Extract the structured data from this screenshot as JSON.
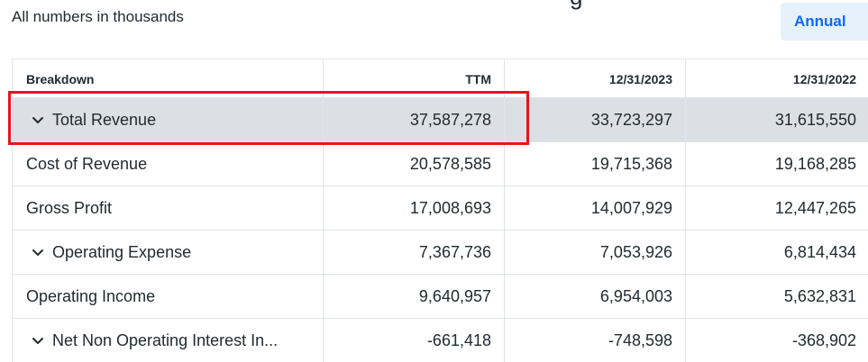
{
  "note": "All numbers in thousands",
  "cut_glyph": "g",
  "frequency": {
    "label": "Annual",
    "accent": "#0f69ff",
    "background": "#e6f2fb"
  },
  "highlight_color": "#e8141c",
  "table": {
    "headers": {
      "breakdown": "Breakdown",
      "ttm": "TTM",
      "y2023": "12/31/2023",
      "y2022": "12/31/2022"
    },
    "rows": [
      {
        "label": "Total Revenue",
        "expandable": true,
        "highlighted": true,
        "ttm": "37,587,278",
        "y2023": "33,723,297",
        "y2022": "31,615,550"
      },
      {
        "label": "Cost of Revenue",
        "expandable": false,
        "ttm": "20,578,585",
        "y2023": "19,715,368",
        "y2022": "19,168,285"
      },
      {
        "label": "Gross Profit",
        "expandable": false,
        "ttm": "17,008,693",
        "y2023": "14,007,929",
        "y2022": "12,447,265"
      },
      {
        "label": "Operating Expense",
        "expandable": true,
        "ttm": "7,367,736",
        "y2023": "7,053,926",
        "y2022": "6,814,434"
      },
      {
        "label": "Operating Income",
        "expandable": false,
        "ttm": "9,640,957",
        "y2023": "6,954,003",
        "y2022": "5,632,831"
      },
      {
        "label": "Net Non Operating Interest In...",
        "expandable": true,
        "ttm": "-661,418",
        "y2023": "-748,598",
        "y2022": "-368,902"
      }
    ]
  }
}
